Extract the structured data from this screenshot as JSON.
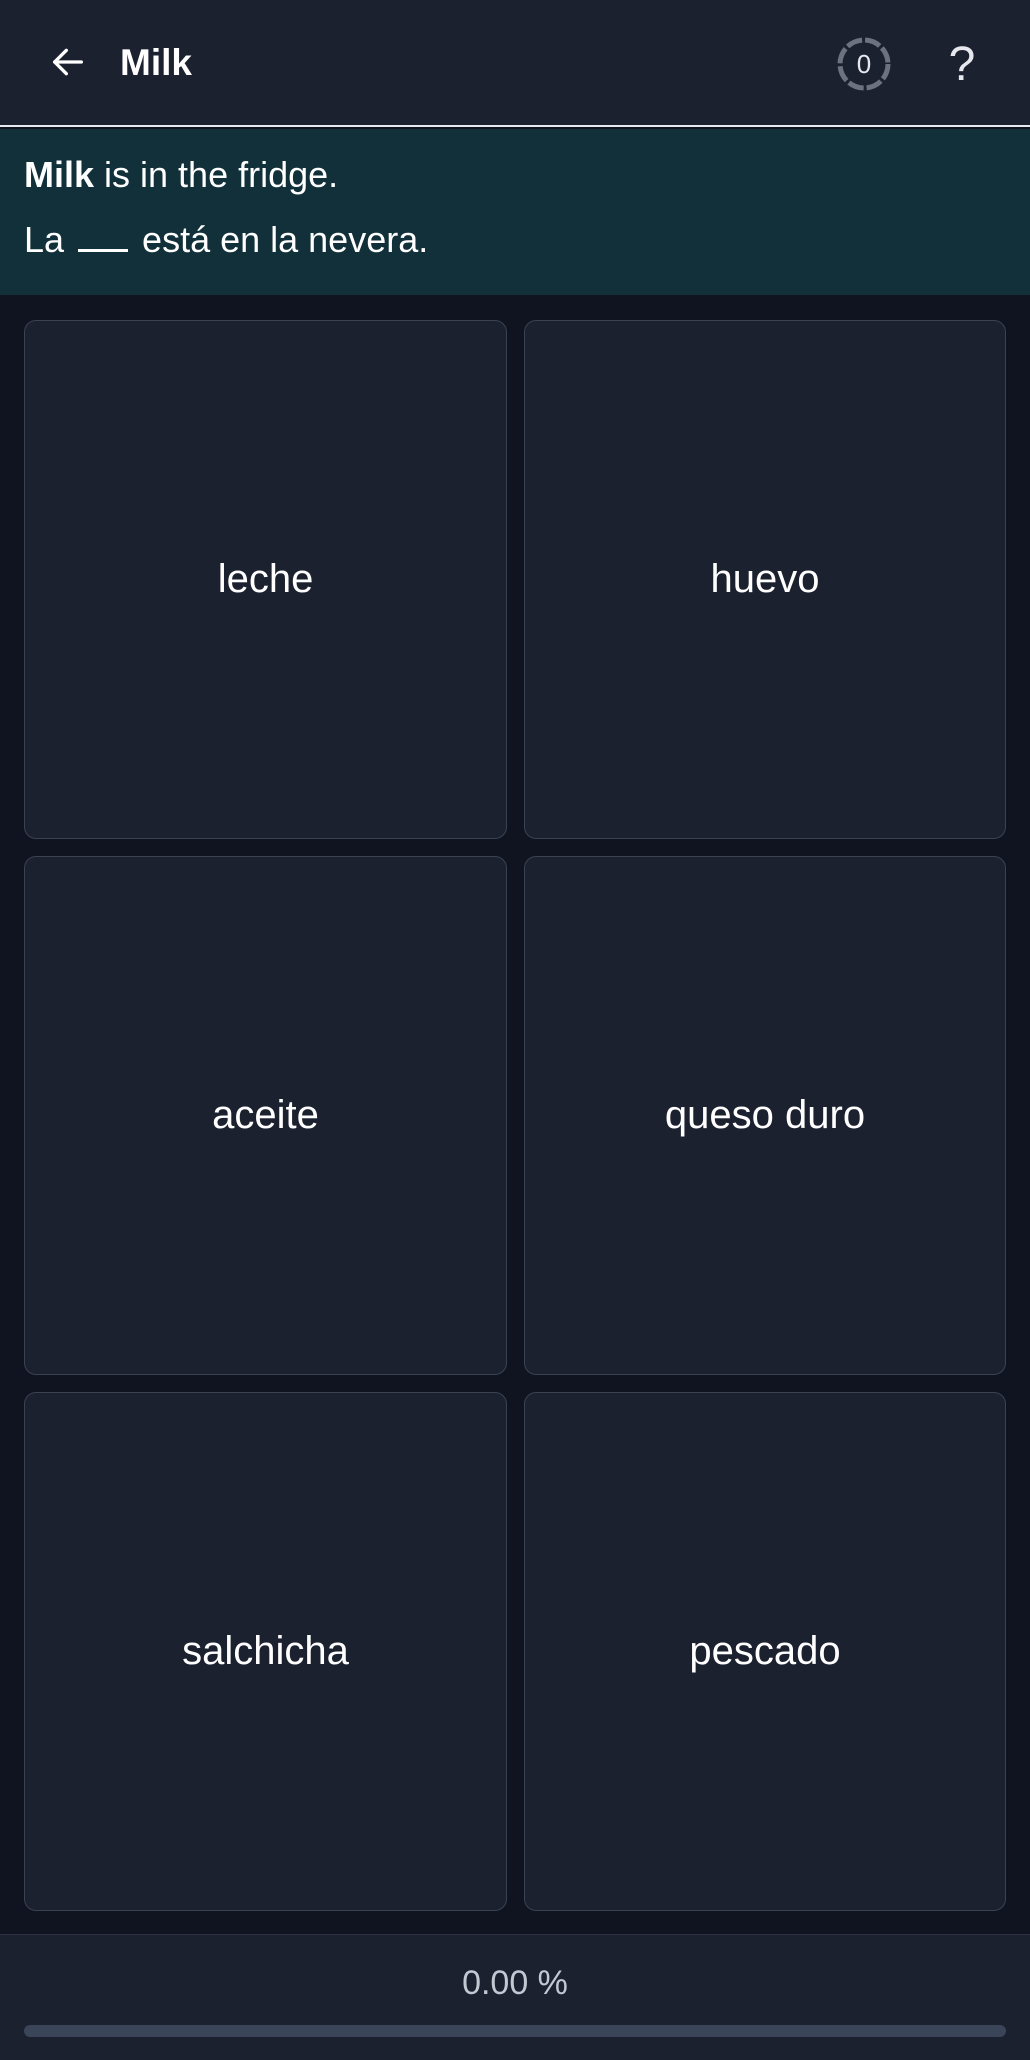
{
  "header": {
    "title": "Milk",
    "timer_count": "0",
    "help_label": "?",
    "back_icon": "arrow-left-icon",
    "timer_icon": "timer-ring-icon"
  },
  "prompt": {
    "line1_bold": "Milk",
    "line1_rest": " is in the fridge.",
    "line2_before": "La ",
    "line2_after": " está en la nevera."
  },
  "options": [
    {
      "label": "leche"
    },
    {
      "label": "huevo"
    },
    {
      "label": "aceite"
    },
    {
      "label": "queso duro"
    },
    {
      "label": "salchicha"
    },
    {
      "label": "pescado"
    }
  ],
  "progress": {
    "label": "0.00 %",
    "value": 0
  },
  "colors": {
    "background": "#0f1420",
    "panel": "#1c2130",
    "prompt_bg": "#12303a",
    "card_border": "#3b4252",
    "track": "#3a4559"
  }
}
